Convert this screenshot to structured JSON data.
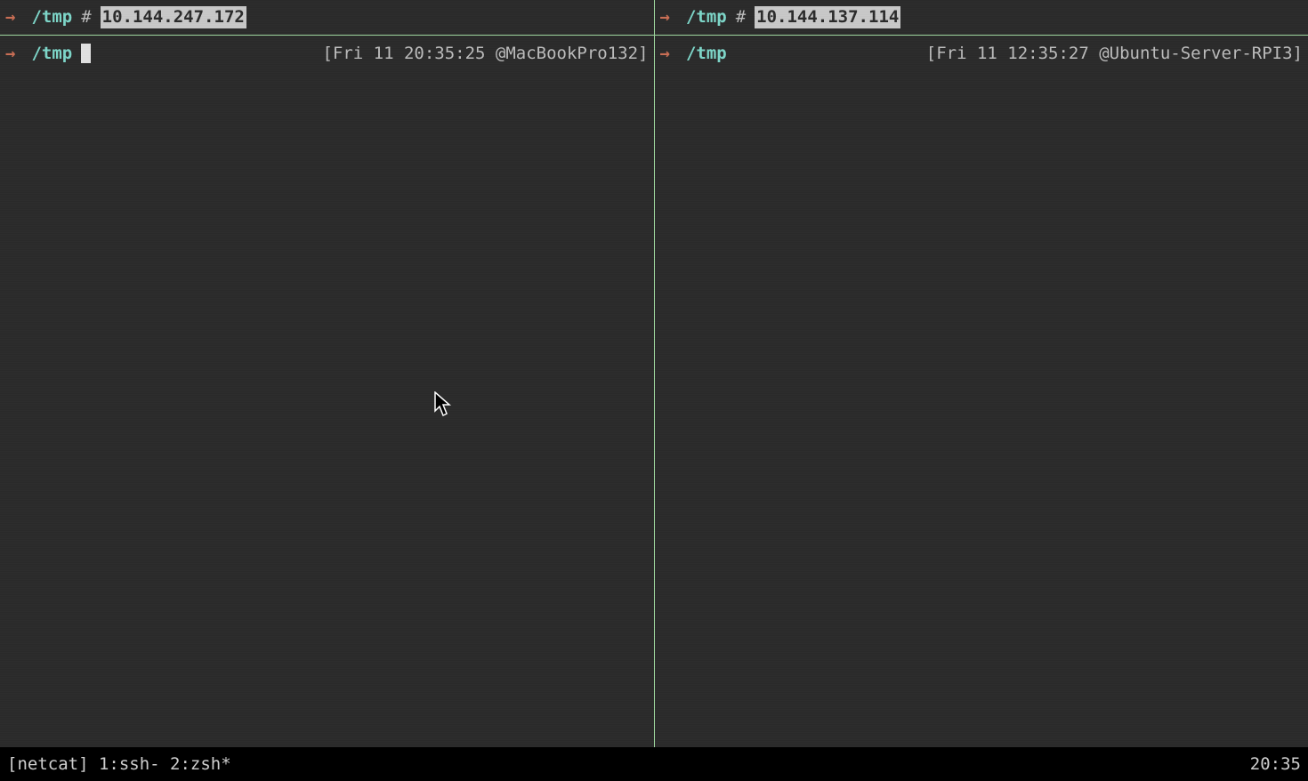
{
  "panes": {
    "left": {
      "top": {
        "arrow": "→",
        "cwd": "/tmp",
        "comment_marker": "#",
        "ip": "10.144.247.172"
      },
      "prompt": {
        "arrow": "→",
        "cwd": "/tmp",
        "rprompt": "[Fri 11 20:35:25 @MacBookPro132]",
        "cursor": true
      }
    },
    "right": {
      "top": {
        "arrow": "→",
        "cwd": "/tmp",
        "comment_marker": "#",
        "ip": "10.144.137.114"
      },
      "prompt": {
        "arrow": "→",
        "cwd": "/tmp",
        "rprompt": "[Fri 11 12:35:27 @Ubuntu-Server-RPI3]",
        "cursor": false
      }
    }
  },
  "status": {
    "session": "[netcat]",
    "windows": "1:ssh- 2:zsh*",
    "clock": "20:35"
  }
}
